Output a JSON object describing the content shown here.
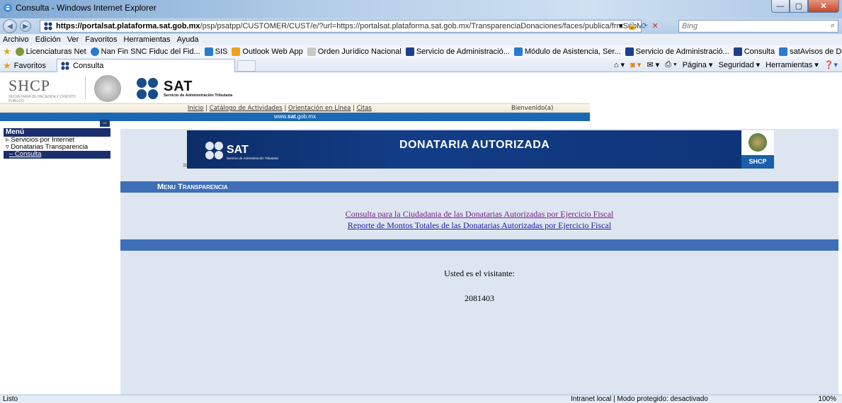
{
  "window": {
    "title": "Consulta - Windows Internet Explorer",
    "min_glyph": "—",
    "max_glyph": "▢",
    "close_glyph": "✕"
  },
  "address": {
    "url_bold": "https://portalsat.plataforma.sat.gob.mx",
    "url_rest": "/psp/psatpp/CUSTOMER/CUST/e/?url=https://portalsat.plataforma.sat.gob.mx/TransparenciaDonaciones/faces/publica/frmSubMenuTr",
    "search_placeholder": "Bing"
  },
  "menubar": [
    "Archivo",
    "Edición",
    "Ver",
    "Favoritos",
    "Herramientas",
    "Ayuda"
  ],
  "links": [
    {
      "label": "Licenciaturas Net",
      "color": "#7a9a3a"
    },
    {
      "label": "Nan Fin SNC Fiduc del Fid...",
      "color": "#2a7ad0"
    },
    {
      "label": "SIS",
      "color": "#2a7ad0"
    },
    {
      "label": "Outlook Web App",
      "color": "#f0a020"
    },
    {
      "label": "Orden Jurídico Nacional",
      "color": "#c8c8c8"
    },
    {
      "label": "Servicio de Administració...",
      "color": "#1b3f8a"
    },
    {
      "label": "Módulo de Asistencia, Ser...",
      "color": "#2a7ad0"
    },
    {
      "label": "Servicio de Administració...",
      "color": "#1b3f8a"
    },
    {
      "label": "Consulta",
      "color": "#1b3f8a"
    },
    {
      "label": "satAvisos de Donación y ...",
      "color": "#2a7ad0"
    }
  ],
  "tabbar": {
    "favorites_label": "Favoritos",
    "tab_label": "Consulta",
    "commands": [
      "Página ▾",
      "Seguridad ▾",
      "Herramientas ▾"
    ]
  },
  "header": {
    "shcp_logo": "SHCP",
    "shcp_subtitle": "SECRETARÍA DE HACIENDA Y CRÉDITO PÚBLICO",
    "sat_logo": "SAT",
    "sat_subtitle": "Servicio de Administración Tributaria",
    "nav": [
      "Inicio",
      "Catálogo de Actividades",
      "Orientación en Línea",
      "Citas"
    ],
    "welcome": "Bienvenido(a)",
    "site_pre": "www.",
    "site_bold": "sat",
    "site_post": ".gob.mx"
  },
  "sidemenu": {
    "collapse_glyph": "–",
    "title": "Menú",
    "items": [
      "▹ Servicios por Internet",
      "▿ Donatarias Transparencia",
      "– Consulta"
    ]
  },
  "main": {
    "banner_title": "DONATARIA AUTORIZADA",
    "banner_sat": "SAT",
    "banner_sat_sub": "Servicio de Administración Tributaria",
    "banner_shcp": "SHCP",
    "banner_dash": "=",
    "section_title": "Menu Transparencia",
    "link1": "Consulta para la Ciudadania de las Donatarias Autorizadas por Ejercicio Fiscal",
    "link2": "Reporte de Montos Totales de las Donatarias Autorizadas por Ejercicio Fiscal",
    "visitor_label": "Usted es el visitante:",
    "visitor_count": "2081403"
  },
  "status": {
    "left": "Listo",
    "zone": "Intranet local | Modo protegido: desactivado",
    "zoom": "100%"
  },
  "colors": {
    "sat_blue": "#1a68b4",
    "section_blue": "#3e6eb7",
    "menu_navy": "#1b2f6e",
    "content_bg": "#dde6f0"
  }
}
